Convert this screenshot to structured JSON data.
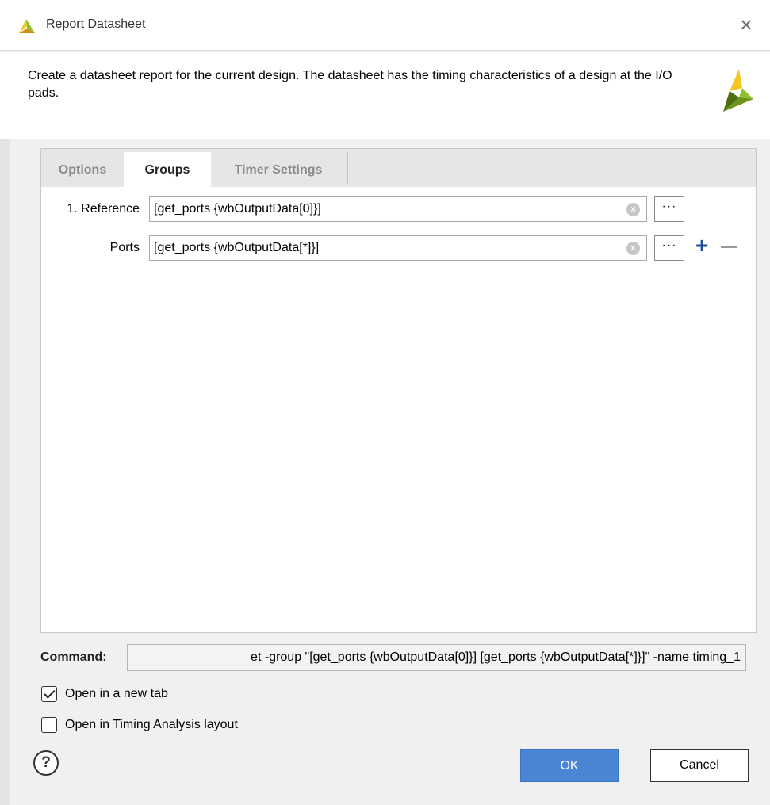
{
  "window": {
    "title": "Report Datasheet",
    "close_glyph": "×",
    "app_icon": "vivado-logo-icon"
  },
  "header": {
    "description": "Create a datasheet report for the current design. The datasheet has the timing characteristics of a design at the I/O pads.",
    "logo": "vivado-logo-icon"
  },
  "tabs": [
    {
      "label": "Options",
      "active": false
    },
    {
      "label": "Groups",
      "active": true
    },
    {
      "label": "Timer Settings",
      "active": false
    }
  ],
  "groups": {
    "reference": {
      "label": "1. Reference",
      "value": "[get_ports {wbOutputData[0]}]",
      "browse_label": "···"
    },
    "ports": {
      "label": "Ports",
      "value": "[get_ports {wbOutputData[*]}]",
      "browse_label": "···"
    },
    "add_label": "+",
    "clear_glyph": "×"
  },
  "command": {
    "label": "Command:",
    "value": "et -group \"[get_ports {wbOutputData[0]}] [get_ports {wbOutputData[*]}]\" -name timing_1"
  },
  "options": {
    "open_new_tab": {
      "label": "Open in a new tab",
      "checked": true
    },
    "open_timing_layout": {
      "label": "Open in Timing Analysis layout",
      "checked": false
    }
  },
  "footer": {
    "help_label": "?",
    "ok_label": "OK",
    "cancel_label": "Cancel"
  },
  "colors": {
    "accent": "#4a86d4",
    "add_icon": "#1b4f96",
    "logo_green": "#8fbf2a",
    "logo_yellow": "#f3c623"
  }
}
